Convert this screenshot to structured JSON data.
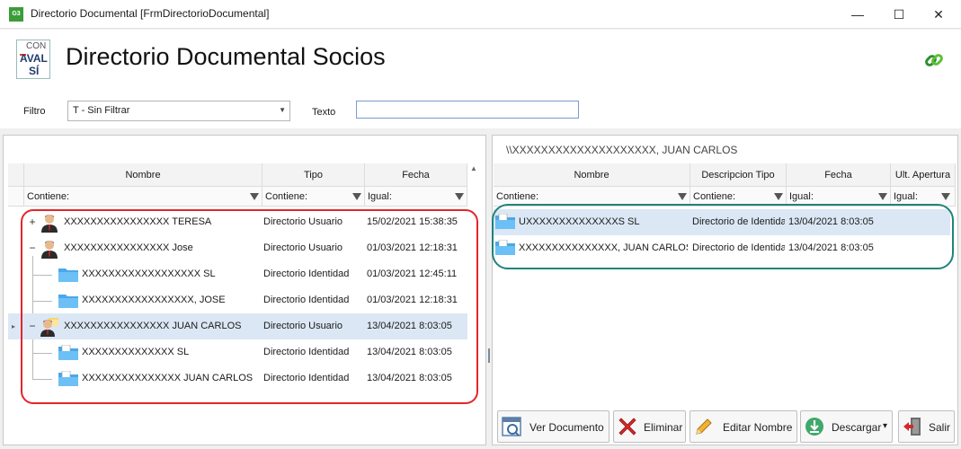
{
  "window": {
    "app_icon_text": "G3",
    "title": "Directorio Documental [FrmDirectorioDocumental]",
    "minimize": "—",
    "maximize": "☐",
    "close": "✕"
  },
  "header": {
    "logo": {
      "line1": "CON",
      "line2": "AVAL",
      "line3": "SÍ"
    },
    "title": "Directorio Documental Socios",
    "link_icon": "link-icon"
  },
  "filters": {
    "filtro_label": "Filtro",
    "filtro_value": "T - Sin Filtrar",
    "texto_label": "Texto",
    "texto_value": ""
  },
  "left_grid": {
    "columns": [
      "Nombre",
      "Tipo",
      "Fecha"
    ],
    "filter_row": [
      "Contiene:",
      "Contiene:",
      "Igual:"
    ],
    "rows": [
      {
        "expander": "+",
        "icon": "user-icon",
        "nombre": "XXXXXXXXXXXXXXXX TERESA",
        "tipo": "Directorio Usuario",
        "fecha": "15/02/2021 15:38:35",
        "level": 0,
        "selected": false
      },
      {
        "expander": "−",
        "icon": "user-icon",
        "nombre": "XXXXXXXXXXXXXXXX Jose",
        "tipo": "Directorio Usuario",
        "fecha": "01/03/2021 12:18:31",
        "level": 0,
        "selected": false
      },
      {
        "expander": "",
        "icon": "folder-icon",
        "nombre": "XXXXXXXXXXXXXXXXXX SL",
        "tipo": "Directorio Identidad",
        "fecha": "01/03/2021 12:45:11",
        "level": 1,
        "selected": false
      },
      {
        "expander": "",
        "icon": "folder-icon",
        "nombre": "XXXXXXXXXXXXXXXXX, JOSE",
        "tipo": "Directorio Identidad",
        "fecha": "01/03/2021 12:18:31",
        "level": 1,
        "selected": false
      },
      {
        "expander": "−",
        "icon": "user-folder-icon",
        "nombre": "XXXXXXXXXXXXXXXX JUAN CARLOS",
        "tipo": "Directorio Usuario",
        "fecha": "13/04/2021 8:03:05",
        "level": 0,
        "selected": true
      },
      {
        "expander": "",
        "icon": "folder-doc-icon",
        "nombre": "XXXXXXXXXXXXXX SL",
        "tipo": "Directorio Identidad",
        "fecha": "13/04/2021 8:03:05",
        "level": 1,
        "selected": false
      },
      {
        "expander": "",
        "icon": "folder-doc-icon",
        "nombre": "XXXXXXXXXXXXXXX JUAN CARLOS",
        "tipo": "Directorio Identidad",
        "fecha": "13/04/2021 8:03:05",
        "level": 1,
        "selected": false
      }
    ],
    "scroll_up": "▲",
    "row_indicator": "▸"
  },
  "right_panel": {
    "path": "\\\\XXXXXXXXXXXXXXXXXXXX, JUAN CARLOS",
    "columns": [
      "Nombre",
      "Descripcion Tipo",
      "Fecha",
      "Ult. Apertura"
    ],
    "filter_row": [
      "Contiene:",
      "Contiene:",
      "Igual:",
      "Igual:"
    ],
    "rows": [
      {
        "icon": "folder-doc-icon",
        "nombre": "UXXXXXXXXXXXXXXS SL",
        "descripcion": "Directorio de Identidad",
        "fecha": "13/04/2021 8:03:05",
        "ult": "",
        "selected": true
      },
      {
        "icon": "folder-doc-icon",
        "nombre": "XXXXXXXXXXXXXXX, JUAN CARLOS",
        "descripcion": "Directorio de Identidad",
        "fecha": "13/04/2021 8:03:05",
        "ult": "",
        "selected": false
      }
    ]
  },
  "toolbar": {
    "ver_documento": "Ver Documento",
    "eliminar": "Eliminar",
    "editar_nombre": "Editar Nombre",
    "descargar": "Descargar",
    "descargar_arrow": "▾",
    "salir": "Salir"
  },
  "colors": {
    "selection": "#dbe7f4",
    "red_outline": "#e3262a",
    "teal_outline": "#20837a",
    "folder": "#4aa8e8"
  }
}
